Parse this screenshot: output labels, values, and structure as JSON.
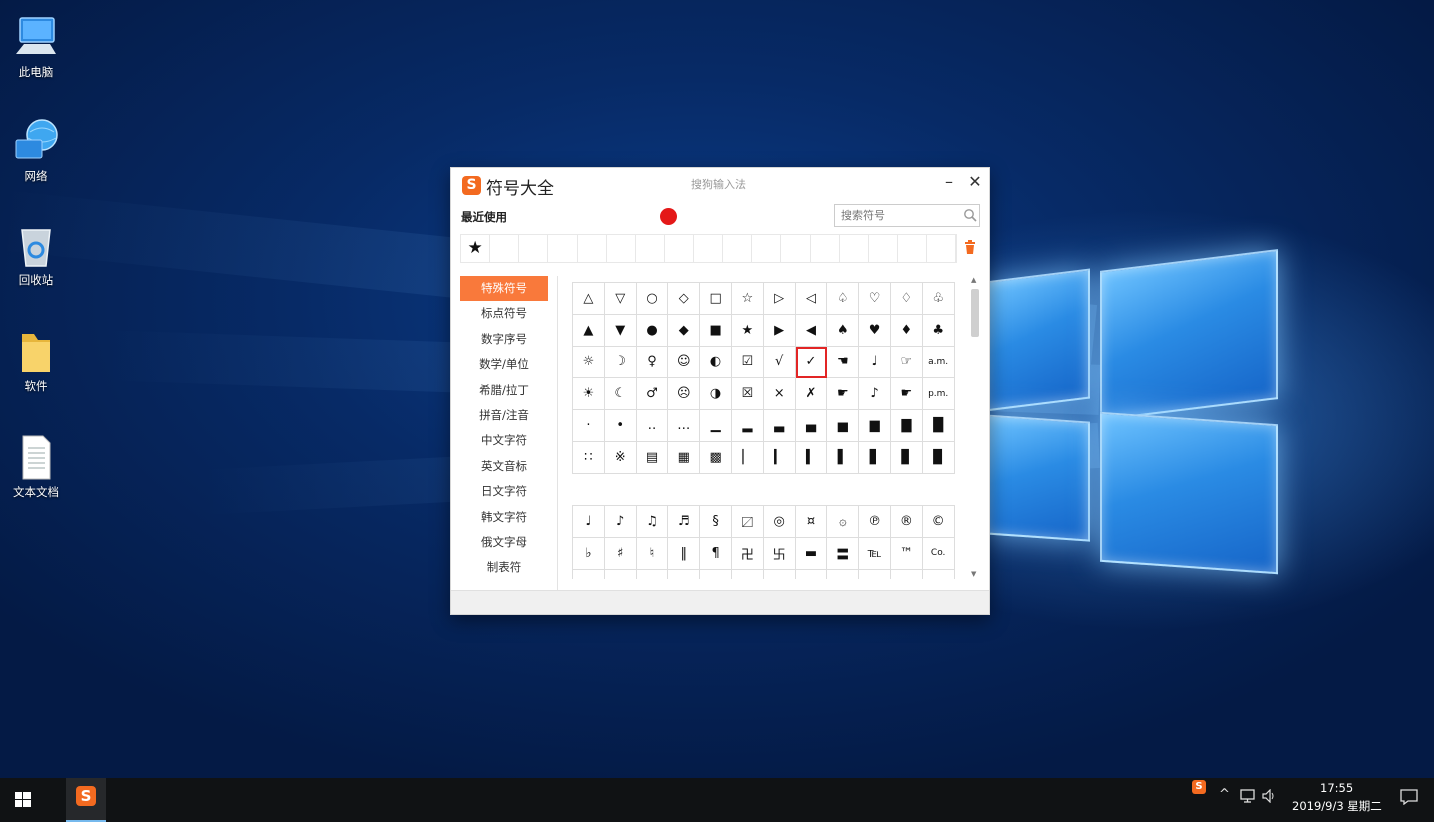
{
  "desktop": {
    "icons": [
      {
        "label": "此电脑",
        "icon": "computer-icon"
      },
      {
        "label": "网络",
        "icon": "network-icon"
      },
      {
        "label": "回收站",
        "icon": "recycle-bin-icon"
      },
      {
        "label": "软件",
        "icon": "folder-icon"
      },
      {
        "label": "文本文档",
        "icon": "text-document-icon"
      }
    ]
  },
  "window": {
    "logo": "S",
    "title": "符号大全",
    "ime_name": "搜狗输入法",
    "minimize": "–",
    "close": "✕",
    "recent_label": "最近使用",
    "search_placeholder": "搜索符号",
    "recent_symbols": [
      "★",
      "",
      "",
      "",
      "",
      "",
      "",
      "",
      "",
      "",
      "",
      "",
      "",
      "",
      "",
      "",
      ""
    ],
    "categories": [
      "特殊符号",
      "标点符号",
      "数字序号",
      "数学/单位",
      "希腊/拉丁",
      "拼音/注音",
      "中文字符",
      "英文音标",
      "日文字符",
      "韩文字符",
      "俄文字母",
      "制表符"
    ],
    "active_category": "特殊符号",
    "grid1": [
      "△",
      "▽",
      "○",
      "◇",
      "□",
      "☆",
      "▷",
      "◁",
      "♤",
      "♡",
      "♢",
      "♧",
      "▲",
      "▼",
      "●",
      "◆",
      "■",
      "★",
      "▶",
      "◀",
      "♠",
      "♥",
      "♦",
      "♣",
      "☼",
      "☽",
      "♀",
      "☺",
      "◐",
      "☑",
      "√",
      "✓",
      "☚",
      "♩",
      "☞",
      "a.m.",
      "☀",
      "☾",
      "♂",
      "☹",
      "◑",
      "☒",
      "×",
      "✗",
      "☛",
      "♪",
      "☛",
      "p.m.",
      "·",
      "•",
      "‥",
      "…",
      "▁",
      "▂",
      "▃",
      "▄",
      "▅",
      "▆",
      "▇",
      "█",
      "∷",
      "※",
      "▤",
      "▦",
      "▩",
      "▏",
      "▎",
      "▍",
      "▌",
      "▋",
      "▊",
      "▉"
    ],
    "selected_symbol": "✓",
    "grid2": [
      "♩",
      "♪",
      "♫",
      "♬",
      "§",
      "〼",
      "◎",
      "¤",
      "۞",
      "℗",
      "®",
      "©",
      "♭",
      "♯",
      "♮",
      "‖",
      "¶",
      "卍",
      "卐",
      "▬",
      "〓",
      "℡",
      "™",
      "Co.",
      "",
      "",
      "",
      "",
      "",
      "",
      "",
      "",
      "",
      "",
      "",
      ""
    ]
  },
  "taskbar": {
    "start_icon": "windows-start-icon",
    "pinned_logo": "S",
    "tray_logo": "S",
    "tray_chevron": "^",
    "tray_network": "network-tray-icon",
    "tray_volume": "volume-icon",
    "time": "17:55",
    "date": "2019/9/3 星期二"
  }
}
